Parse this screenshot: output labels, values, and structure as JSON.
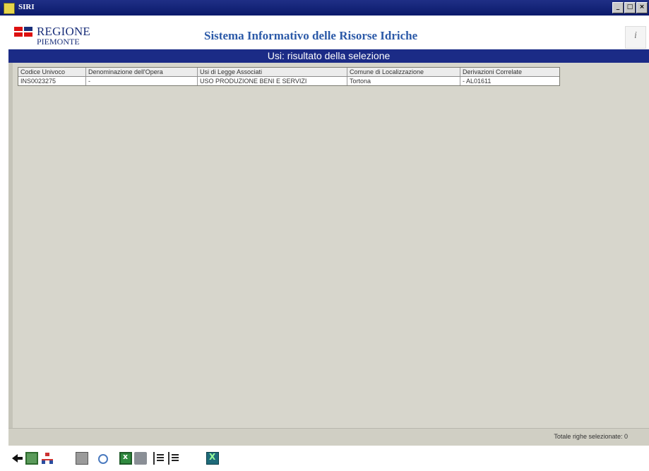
{
  "window": {
    "title": "SIRI",
    "buttons": [
      "_",
      "□",
      "×"
    ]
  },
  "header": {
    "logo_line1": "REGIONE",
    "logo_line2": "PIEMONTE",
    "app_title": "Sistema Informativo delle Risorse Idriche",
    "info_icon": "i"
  },
  "section_title": "Usi: risultato della selezione",
  "table": {
    "columns": [
      "Codice Univoco",
      "Denominazione dell'Opera",
      "Usi di Legge Associati",
      "Comune di Localizzazione",
      "Derivazioni Correlate"
    ],
    "rows": [
      [
        "INS0023275",
        "-",
        "USO PRODUZIONE BENI E SERVIZI",
        "Tortona",
        "- AL01611"
      ]
    ]
  },
  "status": {
    "count_text": "Totale righe selezionate: 0"
  },
  "toolbar": {
    "icons": [
      "back-arrow-icon",
      "exit-door-icon",
      "tree-hierarchy-icon",
      "document-icon",
      "search-icon",
      "excel-icon",
      "print-icon",
      "sort-ascending-icon",
      "sort-descending-icon",
      "export-xls-icon"
    ]
  },
  "colors": {
    "accent_blue": "#1b2b86",
    "title_blue": "#2c5aa8",
    "panel_bg": "#d7d6cc"
  }
}
